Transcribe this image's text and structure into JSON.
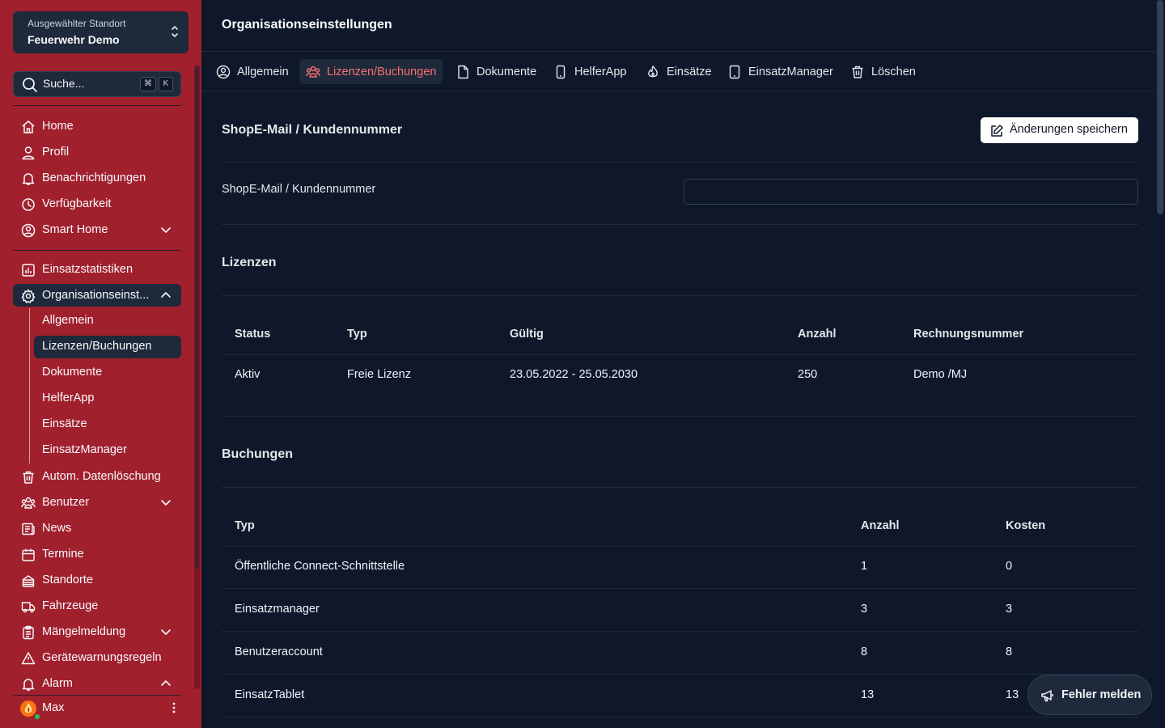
{
  "location": {
    "caption": "Ausgewählter Standort",
    "value": "Feuerwehr Demo"
  },
  "search": {
    "placeholder": "Suche...",
    "kbd1": "⌘",
    "kbd2": "K"
  },
  "sidebar": {
    "items": [
      {
        "label": "Home",
        "icon": "home-icon"
      },
      {
        "label": "Profil",
        "icon": "user-icon"
      },
      {
        "label": "Benachrichtigungen",
        "icon": "bell-icon"
      },
      {
        "label": "Verfügbarkeit",
        "icon": "clock-icon"
      },
      {
        "label": "Smart Home",
        "icon": "user-circle-icon"
      },
      {
        "label": "Einsatzstatistiken",
        "icon": "chart-icon"
      },
      {
        "label": "Organisationseinst...",
        "icon": "gear-icon"
      },
      {
        "label": "Autom. Datenlöschung",
        "icon": "trash-icon"
      },
      {
        "label": "Benutzer",
        "icon": "users-icon"
      },
      {
        "label": "News",
        "icon": "newspaper-icon"
      },
      {
        "label": "Termine",
        "icon": "calendar-icon"
      },
      {
        "label": "Standorte",
        "icon": "building-icon"
      },
      {
        "label": "Fahrzeuge",
        "icon": "truck-icon"
      },
      {
        "label": "Mängelmeldung",
        "icon": "clipboard-icon"
      },
      {
        "label": "Gerätewarnungsregeln",
        "icon": "warning-icon"
      },
      {
        "label": "Alarm",
        "icon": "bell-icon"
      }
    ],
    "subitems": [
      "Allgemein",
      "Lizenzen/Buchungen",
      "Dokumente",
      "HelferApp",
      "Einsätze",
      "EinsatzManager"
    ]
  },
  "user": {
    "name": "Max"
  },
  "page": {
    "title": "Organisationseinstellungen"
  },
  "tabs": [
    {
      "label": "Allgemein",
      "icon": "user-circle-icon"
    },
    {
      "label": "Lizenzen/Buchungen",
      "icon": "users-icon"
    },
    {
      "label": "Dokumente",
      "icon": "document-icon"
    },
    {
      "label": "HelferApp",
      "icon": "phone-icon"
    },
    {
      "label": "Einsätze",
      "icon": "fire-icon"
    },
    {
      "label": "EinsatzManager",
      "icon": "tablet-icon"
    },
    {
      "label": "Löschen",
      "icon": "trash-icon"
    }
  ],
  "shop": {
    "section_title": "ShopE-Mail / Kundennummer",
    "save_label": "Änderungen speichern",
    "field_label": "ShopE-Mail / Kundennummer",
    "field_value": ""
  },
  "licenses": {
    "title": "Lizenzen",
    "headers": [
      "Status",
      "Typ",
      "Gültig",
      "Anzahl",
      "Rechnungsnummer"
    ],
    "rows": [
      [
        "Aktiv",
        "Freie Lizenz",
        "23.05.2022 - 25.05.2030",
        "250",
        "Demo /MJ"
      ]
    ]
  },
  "bookings": {
    "title": "Buchungen",
    "headers": [
      "Typ",
      "Anzahl",
      "Kosten"
    ],
    "rows": [
      [
        "Öffentliche Connect-Schnittstelle",
        "1",
        "0"
      ],
      [
        "Einsatzmanager",
        "3",
        "3"
      ],
      [
        "Benutzeraccount",
        "8",
        "8"
      ],
      [
        "EinsatzTablet",
        "13",
        "13"
      ]
    ]
  },
  "report": {
    "label": "Fehler melden"
  },
  "colors": {
    "sidebar": "#a1202e",
    "background": "#0f172a",
    "panel": "#1e293b",
    "accent": "#f87171"
  }
}
